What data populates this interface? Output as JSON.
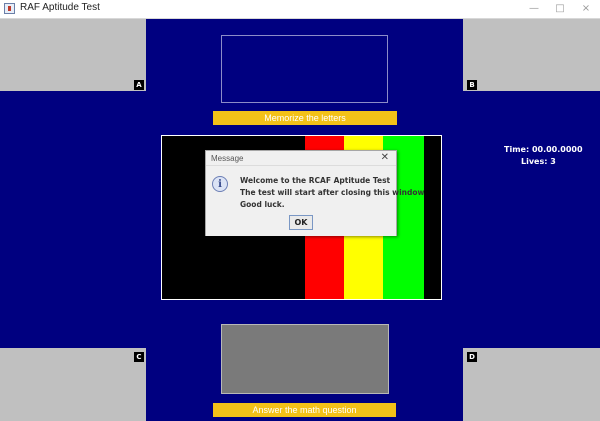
{
  "window": {
    "title": "RAF Aptitude Test",
    "minimize_glyph": "—",
    "maximize_glyph": "□",
    "close_glyph": "×"
  },
  "corners": {
    "top_left_label": "A",
    "top_right_label": "B",
    "bottom_left_label": "C",
    "bottom_right_label": "D"
  },
  "memorize_button": {
    "label": "Memorize the letters"
  },
  "math_button": {
    "label": "Answer the math question"
  },
  "hud": {
    "time": "Time: 00.00.0000",
    "lives": "Lives: 3"
  },
  "game_panel": {
    "bar_colors": [
      "#000000",
      "#ff0000",
      "#ffff00",
      "#00ff00",
      "#000000"
    ]
  },
  "dialog": {
    "title": "Message",
    "close_glyph": "✕",
    "icon": "info-icon",
    "icon_glyph": "i",
    "lines": [
      "Welcome to the RCAF Aptitude Test",
      "The test will start after closing this window",
      "Good luck."
    ],
    "ok_label": "OK"
  },
  "colors": {
    "background": "#000080",
    "corner_panel": "#c0c0c0",
    "button_yellow": "#f3c118",
    "math_panel": "#7a7a7a"
  }
}
